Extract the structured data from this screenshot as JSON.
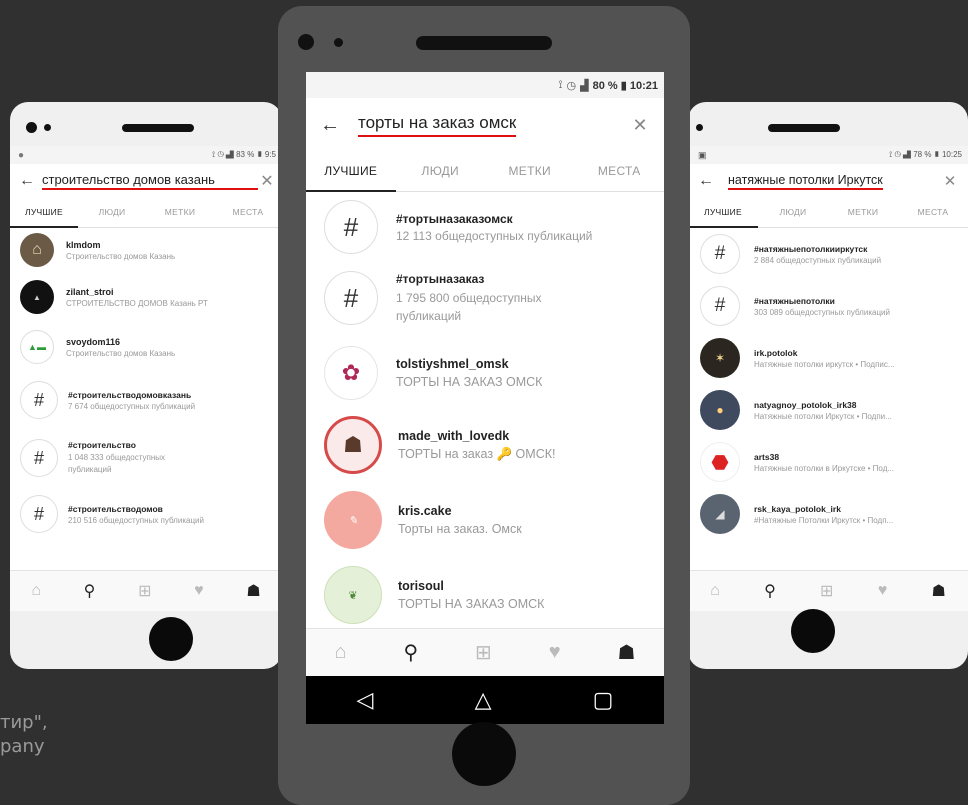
{
  "background": {
    "line1": "тир\",",
    "line2": "pany"
  },
  "left": {
    "status": "83 % ▮ 9:5",
    "query": "строительство домов казань",
    "tabs": [
      "ЛУЧШИЕ",
      "ЛЮДИ",
      "МЕТКИ",
      "МЕСТА"
    ],
    "results": [
      {
        "name": "klmdom",
        "sub": "Строительство домов Казань",
        "icon": "house-avatar",
        "ul": true
      },
      {
        "name": "zilant_stroi",
        "sub": "СТРОИТЕЛЬСТВО ДОМОВ Казань РТ",
        "icon": "zilant-logo-avatar",
        "ul": true
      },
      {
        "name": "svoydom116",
        "sub": "Строительство домов Казань",
        "icon": "svoydom-logo-avatar",
        "ul": true
      },
      {
        "name": "#строительстводомовказань",
        "sub": "7 674 общедоступных публикаций",
        "icon": "hashtag",
        "ul": false
      },
      {
        "name": "#строительство",
        "sub": "1 048 333 общедоступных публикаций",
        "icon": "hashtag",
        "ul": false
      },
      {
        "name": "#строительстводомов",
        "sub": "210 516 общедоступных публикаций",
        "icon": "hashtag",
        "ul": false
      }
    ]
  },
  "middle": {
    "status": "80 % ▮ 10:21",
    "query": "торты на заказ омск",
    "tabs": [
      "ЛУЧШИЕ",
      "ЛЮДИ",
      "МЕТКИ",
      "МЕСТА"
    ],
    "results": [
      {
        "name": "#тортыназаказомск",
        "sub": "12 113 общедоступных публикаций",
        "icon": "hashtag",
        "ul": false
      },
      {
        "name": "#тортыназаказ",
        "sub": "1 795 800 общедоступных публикаций",
        "icon": "hashtag",
        "ul": false
      },
      {
        "name": "tolstiyshmel_omsk",
        "sub": "ТОРТЫ НА ЗАКАЗ ОМСК",
        "icon": "bee-logo-avatar",
        "ul": true
      },
      {
        "name": "made_with_lovedk",
        "sub": "ТОРТЫ на заказ 🔑 ОМСК!",
        "icon": "cake-avatar",
        "ul": true
      },
      {
        "name": "kris.cake",
        "sub": "Торты на заказ. Омск",
        "icon": "pink-logo-avatar",
        "ul": true
      },
      {
        "name": "torisoul",
        "sub": "ТОРТЫ НА ЗАКАЗ ОМСК",
        "icon": "green-logo-avatar",
        "ul": true
      }
    ]
  },
  "right": {
    "status": "78 % ▮ 10:25",
    "query": "натяжные потолки Иркутск",
    "tabs": [
      "ЛУЧШИЕ",
      "ЛЮДИ",
      "МЕТКИ",
      "МЕСТА"
    ],
    "results": [
      {
        "name": "#натяжныепотолкииркутск",
        "sub": "2 884 общедоступных публикаций",
        "icon": "hashtag",
        "ul": false
      },
      {
        "name": "#натяжныепотолки",
        "sub": "303 089 общедоступных публикаций",
        "icon": "hashtag",
        "ul": false
      },
      {
        "name": "irk.potolok",
        "sub": "Натяжные потолки иркутск • Подпис...",
        "icon": "ceiling-avatar",
        "ul": true
      },
      {
        "name": "natyagnoy_potolok_irk38",
        "sub": "Натяжные потолки Иркутск • Подпи...",
        "icon": "lamp-avatar",
        "ul": true
      },
      {
        "name": "arts38",
        "sub": "Натяжные потолки в Иркутске • Под...",
        "icon": "red-shield-avatar",
        "ul": true
      },
      {
        "name": "rsk_kaya_potolok_irk",
        "sub": "#Натяжные Потолки Иркутск • Подп...",
        "icon": "room-avatar",
        "ul": true
      }
    ]
  },
  "colors": {
    "underline": "#dd1111",
    "page_bg": "#303030",
    "phone_body": "#525252"
  }
}
